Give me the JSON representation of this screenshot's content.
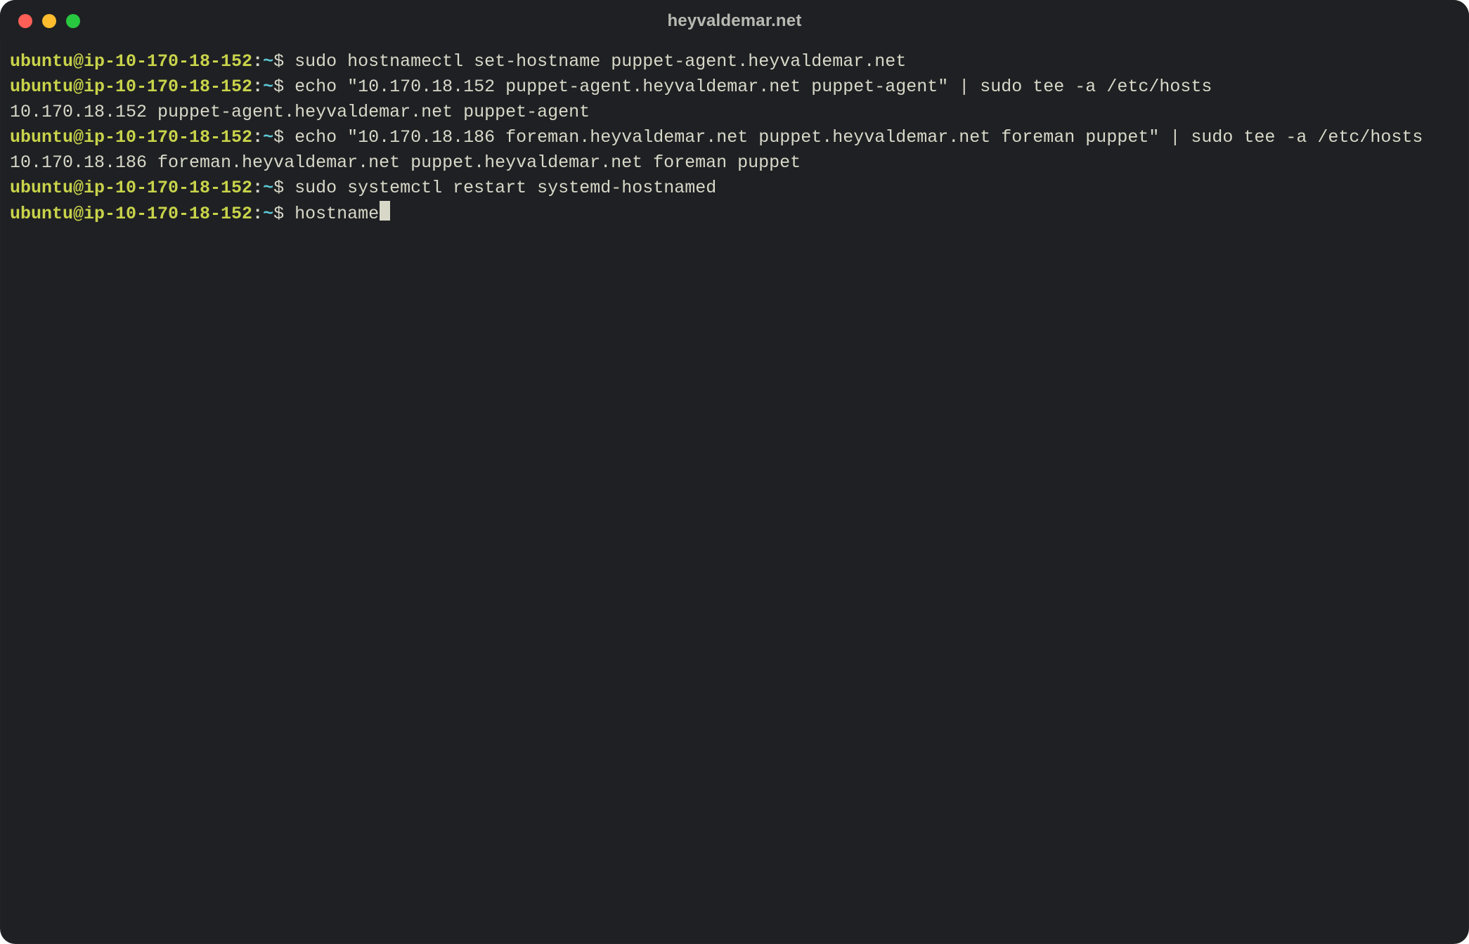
{
  "window": {
    "title": "heyvaldemar.net"
  },
  "colors": {
    "background": "#1f2023",
    "text": "#d8d8c9",
    "prompt_user": "#c8d34a",
    "prompt_path": "#5cc9d6",
    "close": "#ff5f57",
    "minimize": "#febc2e",
    "zoom": "#28c840"
  },
  "prompt": {
    "user_host": "ubuntu@ip-10-170-18-152",
    "colon": ":",
    "path": "~",
    "symbol": "$"
  },
  "terminal": {
    "lines": [
      {
        "type": "prompt",
        "command": "sudo hostnamectl set-hostname puppet-agent.heyvaldemar.net"
      },
      {
        "type": "prompt",
        "command": "echo \"10.170.18.152 puppet-agent.heyvaldemar.net puppet-agent\" | sudo tee -a /etc/hosts"
      },
      {
        "type": "output",
        "text": "10.170.18.152 puppet-agent.heyvaldemar.net puppet-agent"
      },
      {
        "type": "prompt",
        "command": "echo \"10.170.18.186 foreman.heyvaldemar.net puppet.heyvaldemar.net foreman puppet\" | sudo tee -a /etc/hosts"
      },
      {
        "type": "output",
        "text": "10.170.18.186 foreman.heyvaldemar.net puppet.heyvaldemar.net foreman puppet"
      },
      {
        "type": "prompt",
        "command": "sudo systemctl restart systemd-hostnamed"
      },
      {
        "type": "prompt",
        "command": "hostname",
        "cursor": true
      }
    ]
  }
}
